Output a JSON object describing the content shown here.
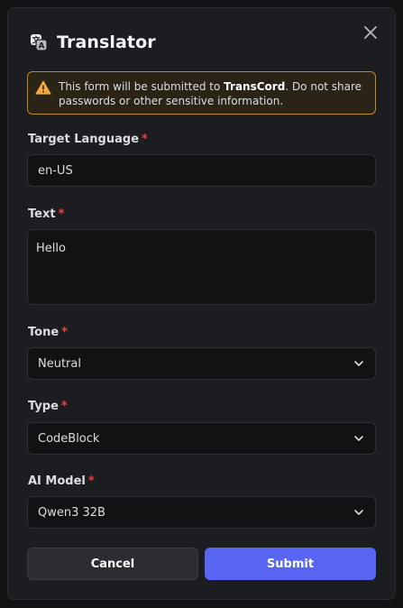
{
  "dialog": {
    "title": "Translator",
    "icon": "translate-icon"
  },
  "warning": {
    "prefix": "This form will be submitted to ",
    "app_name": "TransCord",
    "suffix": ". Do not share passwords or other sensitive information."
  },
  "fields": {
    "target_language": {
      "label": "Target Language",
      "required_mark": "*",
      "value": "en-US"
    },
    "text": {
      "label": "Text",
      "required_mark": "*",
      "value": "Hello"
    },
    "tone": {
      "label": "Tone",
      "required_mark": "*",
      "value": "Neutral"
    },
    "type": {
      "label": "Type",
      "required_mark": "*",
      "value": "CodeBlock"
    },
    "ai_model": {
      "label": "AI Model",
      "required_mark": "*",
      "value": "Qwen3 32B"
    }
  },
  "buttons": {
    "cancel": "Cancel",
    "submit": "Submit"
  },
  "colors": {
    "accent": "#5865f2",
    "warning_border": "#c08a1c",
    "required": "#f23f42"
  }
}
